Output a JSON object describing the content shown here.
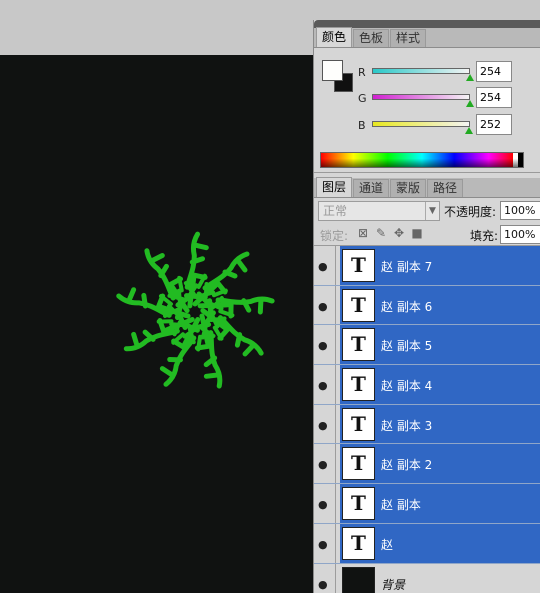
{
  "color_panel": {
    "tabs": [
      "颜色",
      "色板",
      "样式"
    ],
    "active_tab": 0,
    "foreground": "#fefefc",
    "background": "#101010",
    "sliders": [
      {
        "label": "R",
        "value": "254",
        "gradient": [
          "#2ac8c8",
          "#f4f4f4"
        ],
        "thumb_fraction": 0.996
      },
      {
        "label": "G",
        "value": "254",
        "gradient": [
          "#d020d0",
          "#f4f4f4"
        ],
        "thumb_fraction": 0.996
      },
      {
        "label": "B",
        "value": "252",
        "gradient": [
          "#e8e820",
          "#f4f4f4"
        ],
        "thumb_fraction": 0.988
      }
    ]
  },
  "layers_panel": {
    "tabs": [
      "图层",
      "通道",
      "蒙版",
      "路径"
    ],
    "active_tab": 0,
    "blend_mode": "正常",
    "opacity_label": "不透明度:",
    "opacity_value": "100%",
    "lock_label": "锁定:",
    "lock_icons": [
      "transparency-lock-icon",
      "brush-lock-icon",
      "move-lock-icon",
      "padlock-icon"
    ],
    "fill_label": "填充:",
    "fill_value": "100%",
    "layers": [
      {
        "name": "赵 副本 7",
        "type": "text",
        "thumb": "T",
        "selected": true
      },
      {
        "name": "赵 副本 6",
        "type": "text",
        "thumb": "T",
        "selected": true
      },
      {
        "name": "赵 副本 5",
        "type": "text",
        "thumb": "T",
        "selected": true
      },
      {
        "name": "赵 副本 4",
        "type": "text",
        "thumb": "T",
        "selected": true
      },
      {
        "name": "赵 副本 3",
        "type": "text",
        "thumb": "T",
        "selected": true
      },
      {
        "name": "赵 副本 2",
        "type": "text",
        "thumb": "T",
        "selected": true
      },
      {
        "name": "赵 副本",
        "type": "text",
        "thumb": "T",
        "selected": true
      },
      {
        "name": "赵",
        "type": "text",
        "thumb": "T",
        "selected": true
      },
      {
        "name": "背景",
        "type": "background",
        "thumb": "",
        "selected": false
      }
    ]
  },
  "canvas": {
    "background": "#101211",
    "artwork_color": "#22bb22"
  }
}
